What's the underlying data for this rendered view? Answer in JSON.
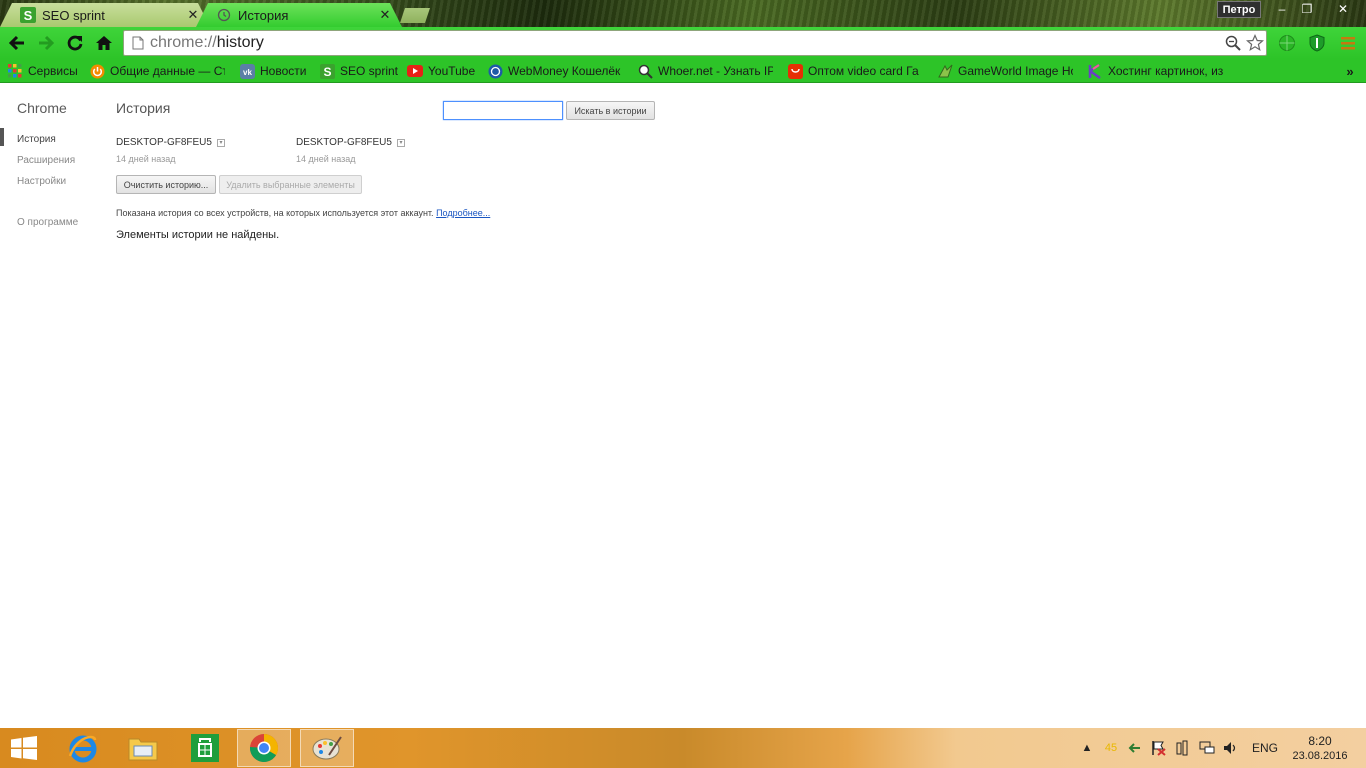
{
  "browser": {
    "tabs": [
      {
        "title": "SEO sprint",
        "close": "✕",
        "active": false
      },
      {
        "title": "История",
        "close": "✕",
        "active": true
      }
    ],
    "profile_name": "Петро",
    "window_controls": {
      "minimize": "‒",
      "maximize": "❐",
      "close": "✕"
    },
    "address": {
      "scheme": "chrome://",
      "path": "history"
    },
    "accent_color": "#33cc2f"
  },
  "bookmarks": [
    {
      "label": "Сервисы",
      "icon": "apps-grid-icon"
    },
    {
      "label": "Общие данные — Ст",
      "icon": "power-icon"
    },
    {
      "label": "Новости",
      "icon": "vk-icon"
    },
    {
      "label": "SEO sprint",
      "icon": "seo-sprint-icon"
    },
    {
      "label": "YouTube",
      "icon": "youtube-icon"
    },
    {
      "label": "WebMoney Кошелёк",
      "icon": "webmoney-icon"
    },
    {
      "label": "Whoer.net - Узнать IP",
      "icon": "magnifier-icon"
    },
    {
      "label": "Оптом video card Га",
      "icon": "aliexpress-icon"
    },
    {
      "label": "GameWorld Image Ho",
      "icon": "gameworld-icon"
    },
    {
      "label": "Хостинг картинок, из",
      "icon": "hosting-icon"
    }
  ],
  "sidebar": {
    "brand": "Chrome",
    "items": [
      {
        "label": "История"
      },
      {
        "label": "Расширения"
      },
      {
        "label": "Настройки"
      },
      {
        "label": "О программе"
      }
    ]
  },
  "main": {
    "title": "История",
    "search_value": "",
    "search_button": "Искать в истории",
    "devices": [
      {
        "name": "DESKTOP-GF8FEU5",
        "time": "14 дней назад"
      },
      {
        "name": "DESKTOP-GF8FEU5",
        "time": "14 дней назад"
      }
    ],
    "clear_button": "Очистить историю...",
    "delete_button": "Удалить выбранные элементы",
    "info_text": "Показана история со всех устройств, на которых используется этот аккаунт.",
    "info_link": "Подробнее...",
    "empty_text": "Элементы истории не найдены."
  },
  "taskbar": {
    "apps": [
      "internet-explorer-icon",
      "file-explorer-icon",
      "store-icon",
      "chrome-icon",
      "paint-icon"
    ],
    "tray_number": "45",
    "language": "ENG",
    "time": "8:20",
    "date": "23.08.2016"
  }
}
